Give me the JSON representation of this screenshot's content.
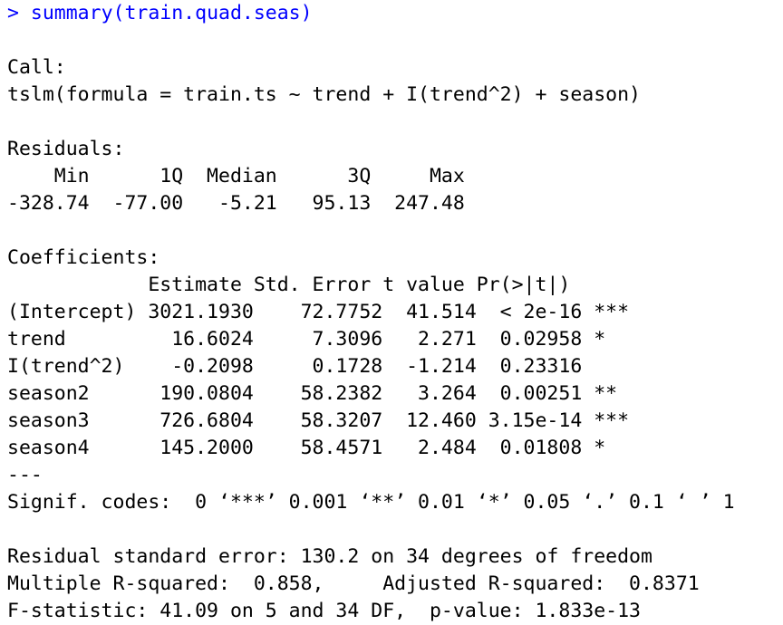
{
  "colors": {
    "command": "#0000ff",
    "output": "#000000",
    "background": "#ffffff"
  },
  "console": {
    "prompt": ">",
    "command": "summary(train.quad.seas)",
    "output_lines": [
      "",
      "Call:",
      "tslm(formula = train.ts ~ trend + I(trend^2) + season)",
      "",
      "Residuals:",
      "    Min      1Q  Median      3Q     Max ",
      "-328.74  -77.00   -5.21   95.13  247.48 ",
      "",
      "Coefficients:",
      "            Estimate Std. Error t value Pr(>|t|)    ",
      "(Intercept) 3021.1930    72.7752  41.514  < 2e-16 ***",
      "trend         16.6024     7.3096   2.271  0.02958 *  ",
      "I(trend^2)    -0.2098     0.1728  -1.214  0.23316    ",
      "season2      190.0804    58.2382   3.264  0.00251 ** ",
      "season3      726.6804    58.3207  12.460 3.15e-14 ***",
      "season4      145.2000    58.4571   2.484  0.01808 *  ",
      "---",
      "Signif. codes:  0 ‘***’ 0.001 ‘**’ 0.01 ‘*’ 0.05 ‘.’ 0.1 ‘ ’ 1",
      "",
      "Residual standard error: 130.2 on 34 degrees of freedom",
      "Multiple R-squared:  0.858,\tAdjusted R-squared:  0.8371 ",
      "F-statistic: 41.09 on 5 and 34 DF,  p-value: 1.833e-13"
    ]
  }
}
